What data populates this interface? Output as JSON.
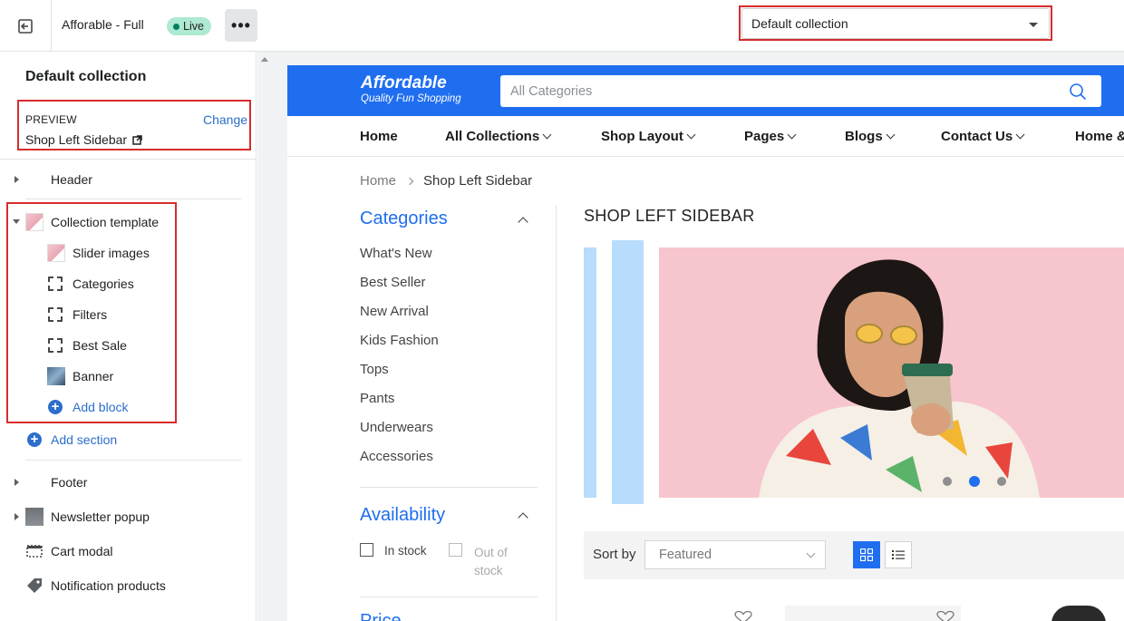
{
  "topbar": {
    "theme_name": "Afforable - Full",
    "live_label": "Live",
    "more_label": "•••",
    "template_select": "Default collection"
  },
  "sidebar": {
    "title": "Default collection",
    "preview": {
      "label": "PREVIEW",
      "change_label": "Change",
      "value": "Shop Left Sidebar"
    },
    "header_label": "Header",
    "collection_template": {
      "label": "Collection template",
      "blocks": [
        {
          "label": "Slider images",
          "icon": "image-thumb-icon"
        },
        {
          "label": "Categories",
          "icon": "block-icon"
        },
        {
          "label": "Filters",
          "icon": "block-icon"
        },
        {
          "label": "Best Sale",
          "icon": "block-icon"
        },
        {
          "label": "Banner",
          "icon": "image-thumb-icon"
        }
      ],
      "add_block_label": "Add block"
    },
    "add_section_label": "Add section",
    "footer_label": "Footer",
    "newsletter_label": "Newsletter popup",
    "cart_modal_label": "Cart modal",
    "notification_label": "Notification products"
  },
  "store": {
    "logo": "Affordable",
    "tagline": "Quality Fun Shopping",
    "search_placeholder": "All Categories",
    "nav": [
      "Home",
      "All Collections",
      "Shop Layout",
      "Pages",
      "Blogs",
      "Contact Us",
      "Home &"
    ],
    "breadcrumb": {
      "home": "Home",
      "current": "Shop Left Sidebar"
    },
    "categories_title": "Categories",
    "categories": [
      "What's New",
      "Best Seller",
      "New Arrival",
      "Kids Fashion",
      "Tops",
      "Pants",
      "Underwears",
      "Accessories"
    ],
    "availability_title": "Availability",
    "in_stock": "In stock",
    "out_of_stock": "Out of stock",
    "price_title": "Price",
    "page_title": "SHOP LEFT SIDEBAR",
    "slider": {
      "dots": 3,
      "active_dot": 2
    },
    "sort_label": "Sort by",
    "sort_value": "Featured"
  },
  "colors": {
    "brand_blue": "#1f6ef0",
    "annotation_red": "#d72c2c",
    "link_blue": "#2c6ecb",
    "live_green": "#aee9d1"
  }
}
